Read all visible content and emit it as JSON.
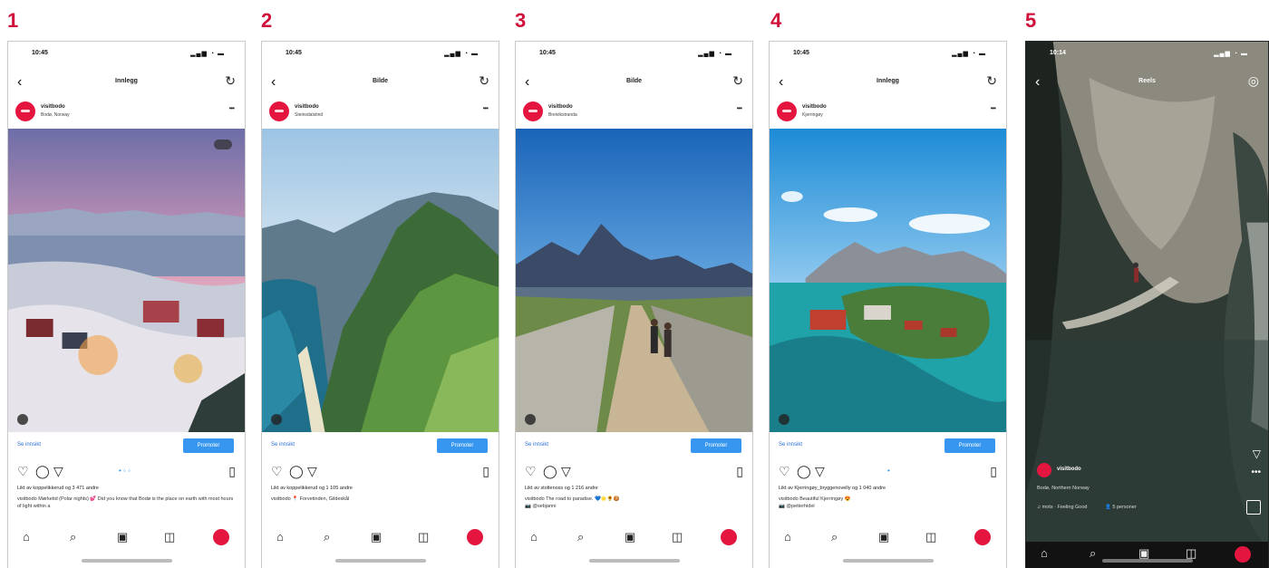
{
  "panels": [
    {
      "number": "1",
      "type": "post",
      "status_time": "10:45",
      "nav_title": "Innlegg",
      "username": "visitbodo",
      "location": "Bodø, Norway",
      "see_insights": "Se innsikt",
      "promote": "Promoter",
      "likes": "Likt av koppelikkerud og 3 471 andre",
      "caption": "visitbodo Mørketid (Polar nights) 💕 Did you know that Bodø is the place on earth with most hours of light within a",
      "has_count_badge": true
    },
    {
      "number": "2",
      "type": "post",
      "status_time": "10:45",
      "nav_title": "Bilde",
      "username": "visitbodo",
      "location": "Steinsdalstind",
      "see_insights": "Se innsikt",
      "promote": "Promoter",
      "likes": "Likt av koppelikkerud og 1 105 andre",
      "caption": "visitbodo 📍 Forvetinden, Gildeskål",
      "has_count_badge": false
    },
    {
      "number": "3",
      "type": "post",
      "status_time": "10:45",
      "nav_title": "Bilde",
      "username": "visitbodo",
      "location": "Breivikstranda",
      "see_insights": "Se innsikt",
      "promote": "Promoter",
      "likes": "Likt av stoltenoss og 1 216 andre",
      "caption": "visitbodo The road to paradise. 💙🌟🌻🍪",
      "caption2": "📷 @sebjanni",
      "has_count_badge": false
    },
    {
      "number": "4",
      "type": "post",
      "status_time": "10:45",
      "nav_title": "Innlegg",
      "username": "visitbodo",
      "location": "Kjerringøy",
      "see_insights": "Se innsikt",
      "promote": "Promoter",
      "likes": "Likt av Kjerringøy_bryggenovelly og 1 040 andre",
      "caption": "visitbodo Beautiful Kjerringøy 😍",
      "caption2": "📷 @petterhidel",
      "has_count_badge": false
    },
    {
      "number": "5",
      "type": "reel",
      "status_time": "10:14",
      "nav_title": "Reels",
      "username": "visitbodo",
      "location": "Bodø, Northern Norway",
      "music": "♫ mots · Feeling Good",
      "people": "👤 5 personer"
    }
  ],
  "icons": {
    "back": "chevron-left-icon",
    "refresh": "refresh-icon",
    "more": "more-icon",
    "like": "heart-icon",
    "comment": "comment-icon",
    "share": "send-icon",
    "save": "bookmark-icon",
    "home": "home-icon",
    "search": "search-icon",
    "reels": "reels-icon",
    "shop": "shop-icon",
    "camera": "camera-icon"
  },
  "colors": {
    "panel_number": "#d0103a",
    "brand": "#e4163f",
    "promote_button": "#3797f0",
    "link": "#2b6fd6"
  }
}
